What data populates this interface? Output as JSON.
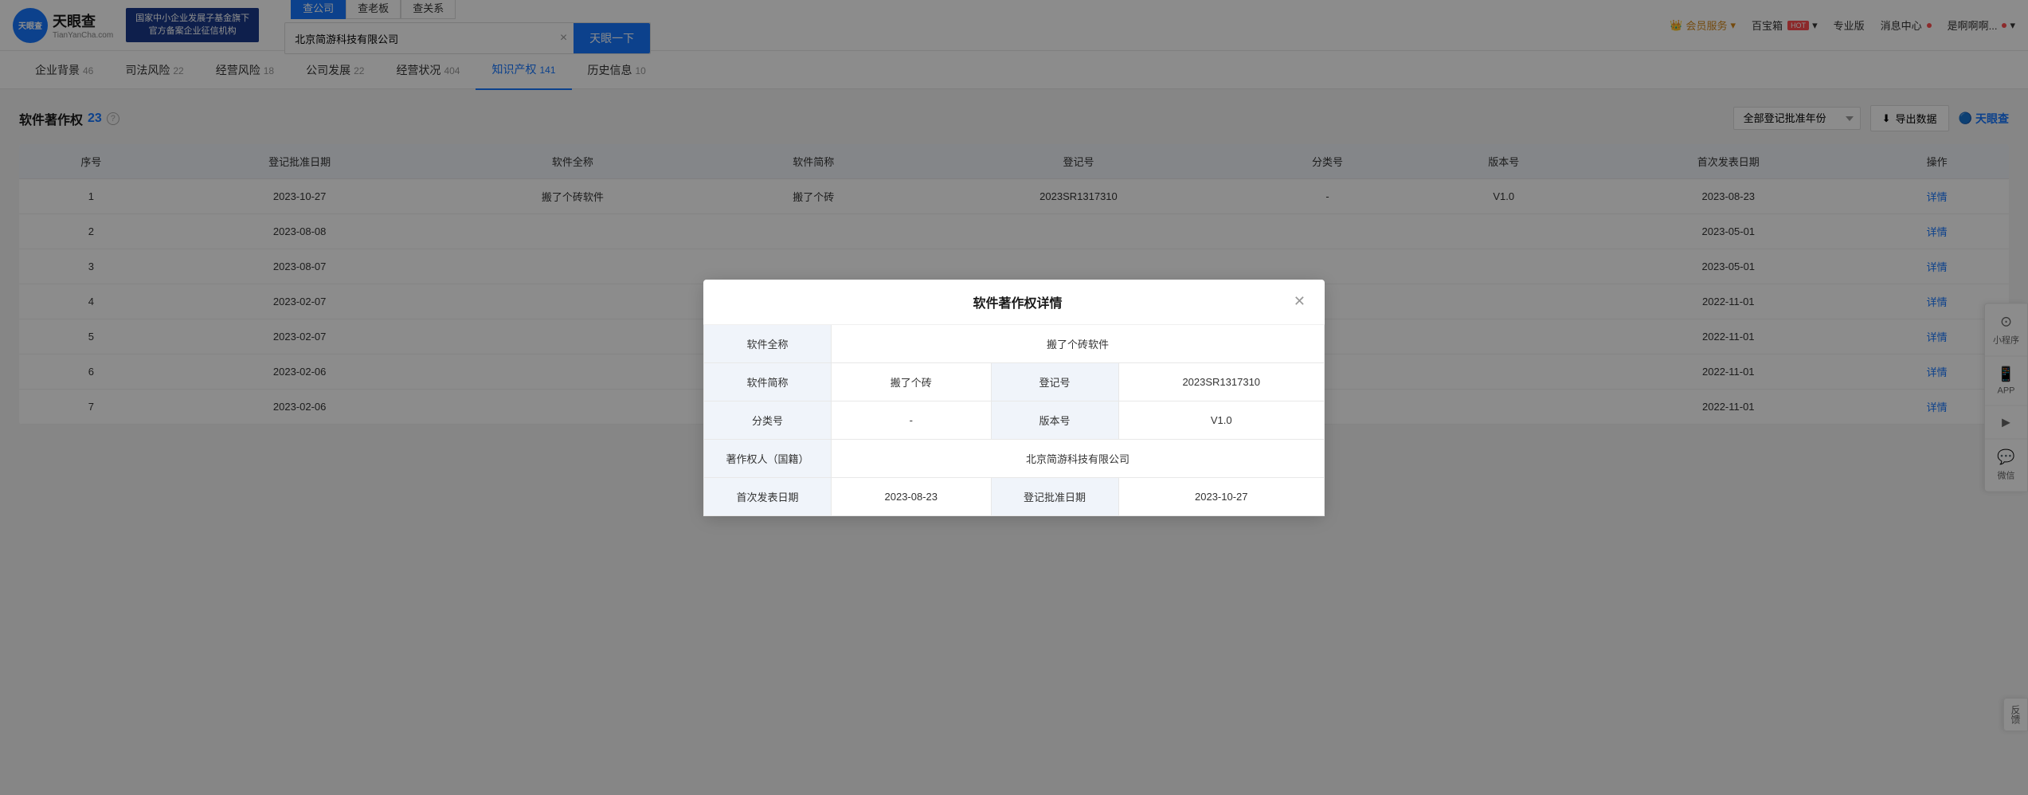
{
  "header": {
    "logo": {
      "title": "天眼查",
      "sub": "TianYanCha.com"
    },
    "banner_line1": "国家中小企业发展子基金旗下",
    "banner_line2": "官方备案企业征信机构",
    "search_tabs": [
      "查公司",
      "查老板",
      "查关系"
    ],
    "active_tab": 0,
    "search_value": "北京简游科技有限公司",
    "search_button": "天眼一下",
    "nav_items": [
      {
        "label": "会员服务",
        "type": "vip"
      },
      {
        "label": "百宝箱",
        "hot": true
      },
      {
        "label": "专业版"
      },
      {
        "label": "消息中心"
      },
      {
        "label": "是啊啊啊..."
      }
    ]
  },
  "nav_tabs": [
    {
      "label": "企业背景",
      "count": "46"
    },
    {
      "label": "司法风险",
      "count": "22"
    },
    {
      "label": "经营风险",
      "count": "18"
    },
    {
      "label": "公司发展",
      "count": "22"
    },
    {
      "label": "经营状况",
      "count": "404"
    },
    {
      "label": "知识产权",
      "count": "141",
      "active": true
    },
    {
      "label": "历史信息",
      "count": "10"
    }
  ],
  "section": {
    "title": "软件著作权",
    "count": "23",
    "year_select_label": "全部登记批准年份",
    "export_label": "导出数据",
    "logo_label": "天眼查"
  },
  "table": {
    "columns": [
      "序号",
      "登记批准日期",
      "软件全称",
      "软件简称",
      "登记号",
      "分类号",
      "版本号",
      "首次发表日期",
      "操作"
    ],
    "rows": [
      {
        "id": 1,
        "approve_date": "2023-10-27",
        "full_name": "搬了个砖软件",
        "short_name": "搬了个砖",
        "reg_no": "2023SR1317310",
        "category": "-",
        "version": "V1.0",
        "publish_date": "2023-08-23",
        "detail": "详情"
      },
      {
        "id": 2,
        "approve_date": "2023-08-08",
        "full_name": "",
        "short_name": "",
        "reg_no": "",
        "category": "",
        "version": "",
        "publish_date": "2023-05-01",
        "detail": "详情"
      },
      {
        "id": 3,
        "approve_date": "2023-08-07",
        "full_name": "",
        "short_name": "",
        "reg_no": "",
        "category": "",
        "version": "",
        "publish_date": "2023-05-01",
        "detail": "详情"
      },
      {
        "id": 4,
        "approve_date": "2023-02-07",
        "full_name": "",
        "short_name": "",
        "reg_no": "",
        "category": "",
        "version": "",
        "publish_date": "2022-11-01",
        "detail": "详情"
      },
      {
        "id": 5,
        "approve_date": "2023-02-07",
        "full_name": "",
        "short_name": "",
        "reg_no": "",
        "category": "",
        "version": "",
        "publish_date": "2022-11-01",
        "detail": "详情"
      },
      {
        "id": 6,
        "approve_date": "2023-02-06",
        "full_name": "",
        "short_name": "",
        "reg_no": "",
        "category": "",
        "version": "",
        "publish_date": "2022-11-01",
        "detail": "详情"
      },
      {
        "id": 7,
        "approve_date": "2023-02-06",
        "full_name": "",
        "short_name": "",
        "reg_no": "",
        "category": "",
        "version": "",
        "publish_date": "2022-11-01",
        "detail": "详情"
      }
    ]
  },
  "modal": {
    "title": "软件著作权详情",
    "fields": [
      {
        "label": "软件全称",
        "value": "搬了个砖软件",
        "span": true
      },
      {
        "label": "软件简称",
        "value": "搬了个砖",
        "label2": "登记号",
        "value2": "2023SR1317310"
      },
      {
        "label": "分类号",
        "value": "-",
        "label2": "版本号",
        "value2": "V1.0"
      },
      {
        "label": "著作权人（国籍）",
        "value": "北京简游科技有限公司",
        "span": true
      },
      {
        "label": "首次发表日期",
        "value": "2023-08-23",
        "label2": "登记批准日期",
        "value2": "2023-10-27"
      }
    ]
  },
  "float_sidebar": [
    {
      "icon": "𝕊",
      "label": "小程序"
    },
    {
      "icon": "📱",
      "label": "APP"
    },
    {
      "icon": "▶",
      "label": ""
    },
    {
      "icon": "💬",
      "label": "微信"
    }
  ],
  "feedback": "反馈"
}
